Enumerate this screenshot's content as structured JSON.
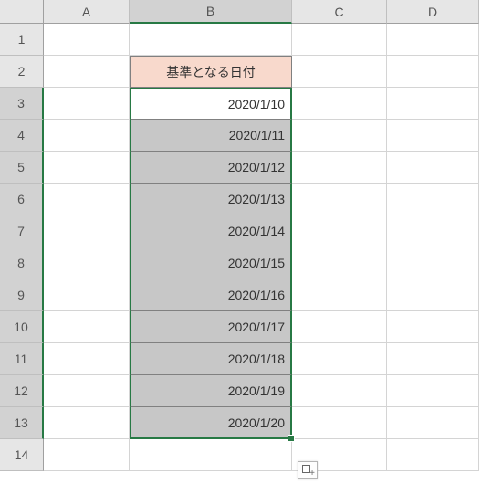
{
  "columns": [
    "A",
    "B",
    "C",
    "D"
  ],
  "rows": [
    "1",
    "2",
    "3",
    "4",
    "5",
    "6",
    "7",
    "8",
    "9",
    "10",
    "11",
    "12",
    "13",
    "14"
  ],
  "active_column": "B",
  "active_rows_start": 3,
  "active_rows_end": 13,
  "cells": {
    "b2": "基準となる日付",
    "b3": "2020/1/10",
    "b4": "2020/1/11",
    "b5": "2020/1/12",
    "b6": "2020/1/13",
    "b7": "2020/1/14",
    "b8": "2020/1/15",
    "b9": "2020/1/16",
    "b10": "2020/1/17",
    "b11": "2020/1/18",
    "b12": "2020/1/19",
    "b13": "2020/1/20"
  }
}
